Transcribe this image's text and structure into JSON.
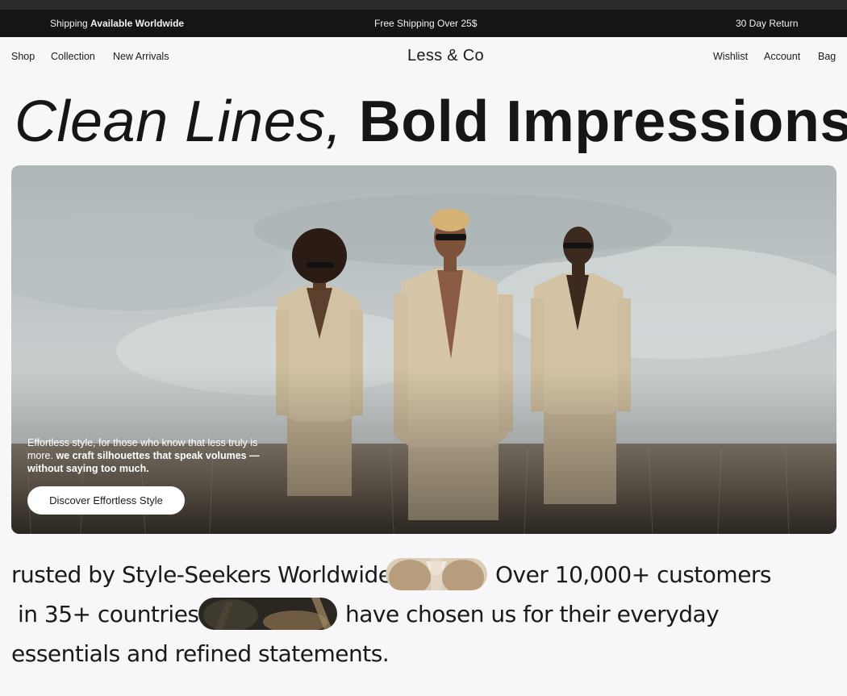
{
  "announcement": {
    "shipping_prefix": "Shipping ",
    "shipping_bold": "Available Worldwide",
    "free_shipping": "Free Shipping Over 25$",
    "returns": "30 Day Return"
  },
  "nav": {
    "left": [
      "Shop",
      "Collection",
      "New Arrivals"
    ],
    "logo": "Less & Co",
    "right": [
      "Wishlist",
      "Account",
      "Bag"
    ]
  },
  "headline": {
    "italic": "Clean Lines,",
    "regular": "Bold Impressions"
  },
  "hero": {
    "text_regular": "Effortless style, for those who know that less truly is more. ",
    "text_bold": "we craft silhouettes that speak volumes —without saying too much.",
    "cta_label": "Discover Effortless Style"
  },
  "trust": {
    "line1_a": "rusted by Style-Seekers Worldwide",
    "line1_b": "Over 10,000+ customers",
    "line2_a": "in 35+ countries",
    "line2_b": "have chosen us for their everyday",
    "line3": "essentials and refined statements."
  },
  "colors": {
    "announcement_bg": "#151515",
    "page_bg": "#f7f7f9",
    "suit_beige": "#d4c3a6"
  }
}
